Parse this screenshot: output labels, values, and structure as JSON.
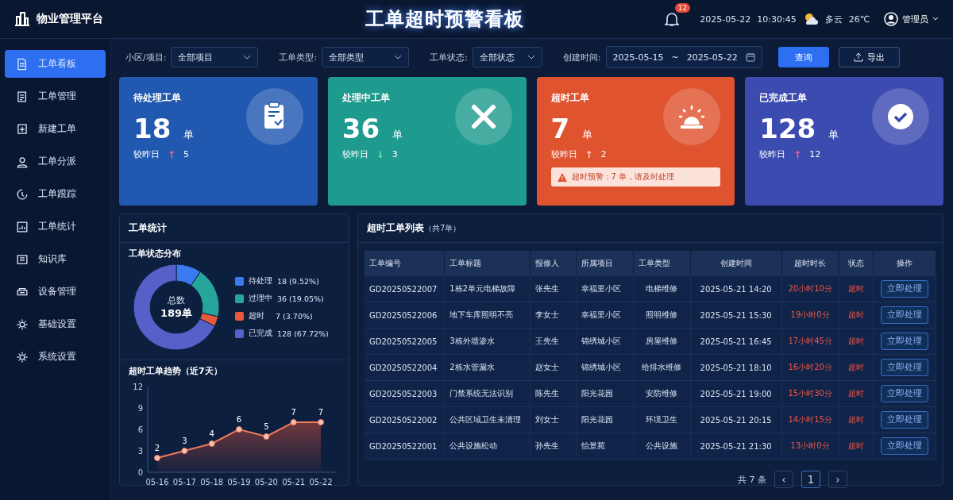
{
  "header": {
    "brand": "物业管理平台",
    "title": "工单超时预警看板",
    "notification_count": "12",
    "date": "2025-05-22",
    "time": "10:30:45",
    "weather": "多云",
    "temperature": "26℃",
    "user": "管理员"
  },
  "sidebar": {
    "items": [
      {
        "label": "工单看板",
        "selected": true
      },
      {
        "label": "工单管理",
        "selected": false
      },
      {
        "label": "新建工单",
        "selected": false
      },
      {
        "label": "工单分派",
        "selected": false
      },
      {
        "label": "工单跟踪",
        "selected": false
      },
      {
        "label": "工单统计",
        "selected": false
      },
      {
        "label": "知识库",
        "selected": false
      },
      {
        "label": "设备管理",
        "selected": false
      },
      {
        "label": "基础设置",
        "selected": false
      },
      {
        "label": "系统设置",
        "selected": false
      }
    ]
  },
  "filters": {
    "community": {
      "label": "小区/项目:",
      "value": "全部项目"
    },
    "type": {
      "label": "工单类型:",
      "value": "全部类型"
    },
    "status": {
      "label": "工单状态:",
      "value": "全部状态"
    },
    "created": {
      "label": "创建时间:",
      "start": "2025-05-15",
      "separator": "~",
      "end": "2025-05-22"
    },
    "buttons": [
      {
        "label": "查询",
        "kind": "primary"
      },
      {
        "label": "导出",
        "kind": "export"
      }
    ]
  },
  "cards": [
    {
      "title": "待处理工单",
      "value": "18",
      "unit": "单",
      "compare_label": "较昨日",
      "trend": "↑",
      "delta": "5",
      "color": "#2158b0"
    },
    {
      "title": "处理中工单",
      "value": "36",
      "unit": "单",
      "compare_label": "较昨日",
      "trend": "↓",
      "delta": "3",
      "color": "#1f9a8e"
    },
    {
      "title": "超时工单",
      "value": "7",
      "unit": "单",
      "compare_label": "较昨日",
      "trend": "↑",
      "delta": "2",
      "color": "#e0532f",
      "alert": "超时预警：7 单，请及时处理"
    },
    {
      "title": "已完成工单",
      "value": "128",
      "unit": "单",
      "compare_label": "较昨日",
      "trend": "↑",
      "delta": "12",
      "color": "#3b4bb0"
    }
  ],
  "stats": {
    "title": "工单统计",
    "distribution": {
      "title": "工单状态分布",
      "center_label": "总数",
      "center_value": "189单",
      "legend": [
        {
          "text": "18 (9.52%)",
          "color": "#3a7bf0"
        },
        {
          "text": "36 (19.05%)",
          "color": "#26a69a"
        },
        {
          "text": "7 (3.70%)",
          "color": "#e8583a"
        },
        {
          "text": "128 (67.72%)",
          "color": "#5561c9"
        }
      ],
      "chart_data": {
        "type": "donut",
        "categories": [
          "待处理",
          "过理中",
          "超时",
          "已完成"
        ],
        "values": [
          9.52,
          19.05,
          3.7,
          67.72
        ]
      }
    },
    "trend": {
      "title": "超时工单趋势（近7天）",
      "chart_data": {
        "type": "area",
        "categories": [
          "05-16",
          "05-17",
          "05-18",
          "05-19",
          "05-20",
          "05-21",
          "05-22"
        ],
        "series": [
          {
            "color": "#f07a5a",
            "values": [
              2,
              3,
              4,
              6,
              5,
              7,
              7
            ]
          }
        ],
        "ylim": [
          0,
          12
        ],
        "yticks": [
          0,
          3,
          6,
          9,
          12
        ],
        "data_labels": true
      }
    }
  },
  "table": {
    "title": "超时工单列表",
    "count": "（共7单）",
    "columns": [
      "工单编号",
      "工单标题",
      "报修人",
      "所属项目",
      "工单类型",
      "创建时间",
      "超时时长",
      "状态",
      "操作"
    ],
    "rows": [
      [
        "GD20250522007",
        "1栋2单元电梯故障",
        "张先生",
        "幸福里小区",
        "电梯维修",
        "2025-05-21 14:20",
        "20小时10分",
        "超时",
        "立即处理"
      ],
      [
        "GD20250522006",
        "地下车库照明不亮",
        "李女士",
        "幸福里小区",
        "照明维修",
        "2025-05-21 15:30",
        "19小时0分",
        "超时",
        "立即处理"
      ],
      [
        "GD20250522005",
        "3栋外墙渗水",
        "王先生",
        "锦绣城小区",
        "房屋维修",
        "2025-05-21 16:45",
        "17小时45分",
        "超时",
        "立即处理"
      ],
      [
        "GD20250522004",
        "2栋水管漏水",
        "赵女士",
        "锦绣城小区",
        "给排水维修",
        "2025-05-21 18:10",
        "16小时20分",
        "超时",
        "立即处理"
      ],
      [
        "GD20250522003",
        "门禁系统无法识别",
        "陈先生",
        "阳光花园",
        "安防维修",
        "2025-05-21 19:00",
        "15小时30分",
        "超时",
        "立即处理"
      ],
      [
        "GD20250522002",
        "公共区域卫生未清理",
        "刘女士",
        "阳光花园",
        "环境卫生",
        "2025-05-21 20:15",
        "14小时15分",
        "超时",
        "立即处理"
      ],
      [
        "GD20250522001",
        "公共设施松动",
        "孙先生",
        "怡景苑",
        "公共设施",
        "2025-05-21 21:30",
        "13小时0分",
        "超时",
        "立即处理"
      ]
    ],
    "pagination": {
      "total": "共 7 条",
      "prev": "‹",
      "page": "1",
      "next": "›"
    }
  }
}
